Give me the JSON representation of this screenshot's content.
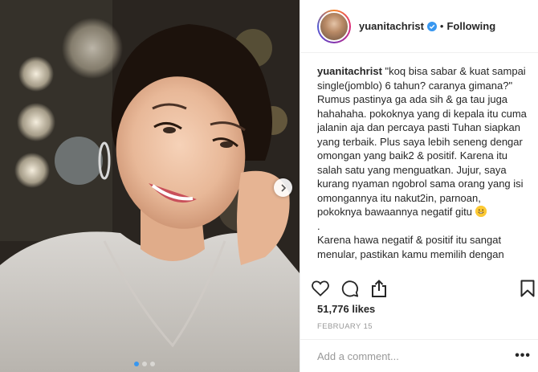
{
  "post": {
    "username": "yuanitachrist",
    "separator": "•",
    "follow_status": "Following",
    "caption_username": "yuanitachrist",
    "caption_text": "\"koq bisa sabar & kuat sampai single(jomblo) 6 tahun? caranya gimana?\"\nRumus pastinya ga ada sih & ga tau juga hahahaha. pokoknya yang di kepala itu cuma jalanin aja dan percaya pasti Tuhan siapkan yang terbaik. Plus saya lebih seneng dengar omongan yang baik2 & positif. Karena itu salah satu yang menguatkan. Jujur, saya kurang nyaman ngobrol sama orang yang isi omongannya itu nakut2in, parnoan, pokoknya bawaannya negatif gitu",
    "caption_tail": "\n.\nKarena hawa negatif & positif itu sangat menular, pastikan kamu memilih dengan",
    "likes": "51,776 likes",
    "date": "FEBRUARY 15",
    "comment_placeholder": "Add a comment...",
    "more_label": "•••"
  },
  "icons": {
    "verified": "verified-badge-icon",
    "like": "heart-icon",
    "comment": "comment-bubble-icon",
    "share": "share-icon",
    "save": "bookmark-icon",
    "next": "chevron-right-icon"
  },
  "colors": {
    "verified": "#3897f0",
    "carousel_active": "#3897f0",
    "muted": "#999999",
    "text": "#262626"
  }
}
